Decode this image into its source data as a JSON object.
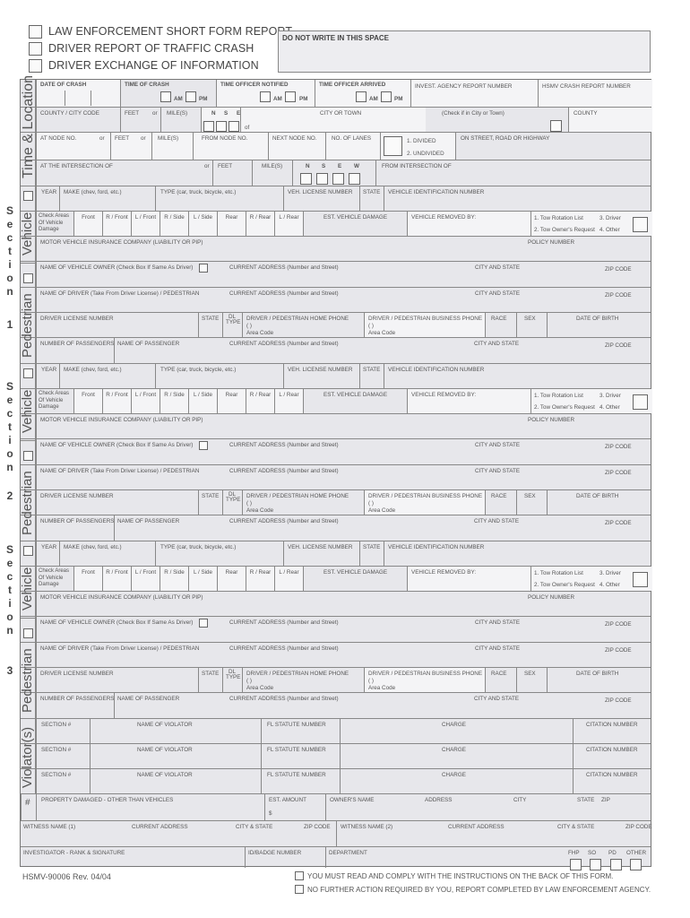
{
  "header": {
    "options": [
      {
        "label": "LAW ENFORCEMENT SHORT FORM REPORT",
        "checked": false
      },
      {
        "label": "DRIVER REPORT OF TRAFFIC CRASH",
        "checked": false
      },
      {
        "label": "DRIVER EXCHANGE OF INFORMATION",
        "checked": false
      }
    ],
    "do_not_write": "DO NOT WRITE IN THIS SPACE"
  },
  "time_location": {
    "section_label": "Time & Location",
    "date_of_crash": "DATE OF CRASH",
    "time_of_crash": "TIME OF CRASH",
    "time_officer_notified": "TIME OFFICER NOTIFIED",
    "time_officer_arrived": "TIME OFFICER ARRIVED",
    "am": "AM",
    "pm": "PM",
    "invest_agency_report_number": "INVEST. AGENCY REPORT NUMBER",
    "hsmv_crash_report_number": "HSMV CRASH REPORT NUMBER",
    "county_city_code": "COUNTY / CITY CODE",
    "feet": "FEET",
    "or": "or",
    "miles": "MILE(S)",
    "directions": [
      "N",
      "S",
      "E",
      "W"
    ],
    "of": "of",
    "city_or_town": "CITY OR TOWN",
    "check_if_in_city": "(Check if in City or Town)",
    "county": "COUNTY",
    "at_node_no": "AT NODE NO.",
    "from_node_no": "FROM NODE NO.",
    "next_node_no": "NEXT NODE NO.",
    "no_of_lanes": "NO. OF LANES",
    "divided": "1. DIVIDED",
    "undivided": "2. UNDIVIDED",
    "on_street": "ON STREET, ROAD OR HIGHWAY",
    "at_intersection_of": "AT THE INTERSECTION OF",
    "from_intersection_of": "FROM INTERSECTION OF"
  },
  "section_common": {
    "section_word": "Section",
    "vehicle_label": "Vehicle",
    "pedestrian_label": "Pedestrian",
    "year": "YEAR",
    "make": "MAKE (chev, ford, etc.)",
    "type": "TYPE (car, truck, bicycle, etc.)",
    "veh_license_number": "VEH. LICENSE NUMBER",
    "state": "STATE",
    "vin": "VEHICLE IDENTIFICATION NUMBER",
    "check_areas": "Check Areas Of Vehicle Damage",
    "damage_areas": [
      "Front",
      "R / Front",
      "L / Front",
      "R / Side",
      "L / Side",
      "Rear",
      "R / Rear",
      "L / Rear"
    ],
    "est_vehicle_damage": "EST. VEHICLE DAMAGE",
    "vehicle_removed_by": "VEHICLE REMOVED BY:",
    "tow_options": [
      "1. Tow Rotation List",
      "3. Driver",
      "2. Tow Owner's Request",
      "4. Other"
    ],
    "insurance_company": "MOTOR VEHICLE INSURANCE COMPANY (LIABILITY OR PIP)",
    "policy_number": "POLICY NUMBER",
    "name_of_owner": "NAME OF VEHICLE OWNER (Check Box If Same As Driver)",
    "current_address": "CURRENT ADDRESS (Number and Street)",
    "city_and_state": "CITY AND STATE",
    "zip_code": "ZIP CODE",
    "name_of_driver": "NAME OF DRIVER (Take From Driver License) / PEDESTRIAN",
    "driver_license_number": "DRIVER LICENSE NUMBER",
    "dl_type": "DL TYPE",
    "home_phone": "DRIVER / PEDESTRIAN HOME PHONE",
    "business_phone": "DRIVER / PEDESTRIAN BUSINESS PHONE",
    "phone_paren": "(          )",
    "area_code": "Area Code",
    "race": "RACE",
    "sex": "SEX",
    "date_of_birth": "DATE OF BIRTH",
    "number_of_passengers": "NUMBER OF PASSENGERS",
    "name_of_passenger": "NAME OF PASSENGER"
  },
  "sections": [
    {
      "number": "1"
    },
    {
      "number": "2"
    },
    {
      "number": "3"
    }
  ],
  "violators": {
    "section_label": "Violator(s)",
    "rows": [
      {
        "section": "SECTION #",
        "name": "NAME OF VIOLATOR",
        "statute": "FL STATUTE NUMBER",
        "charge": "CHARGE",
        "citation": "CITATION NUMBER"
      },
      {
        "section": "SECTION #",
        "name": "NAME OF VIOLATOR",
        "statute": "FL STATUTE NUMBER",
        "charge": "CHARGE",
        "citation": "CITATION NUMBER"
      },
      {
        "section": "SECTION #",
        "name": "NAME OF VIOLATOR",
        "statute": "FL STATUTE NUMBER",
        "charge": "CHARGE",
        "citation": "CITATION NUMBER"
      }
    ]
  },
  "property": {
    "hash": "#",
    "property_damaged": "PROPERTY DAMAGED - OTHER THAN VEHICLES",
    "est_amount": "EST. AMOUNT",
    "dollar": "$",
    "owners_name": "OWNER'S NAME",
    "address": "ADDRESS",
    "city": "CITY",
    "state": "STATE",
    "zip": "ZIP"
  },
  "witness": {
    "witness1": "WITNESS NAME  (1)",
    "witness2": "WITNESS NAME  (2)",
    "current_address": "CURRENT ADDRESS",
    "city_state": "CITY & STATE",
    "zip_code": "ZIP CODE"
  },
  "investigator": {
    "rank_signature": "INVESTIGATOR - RANK & SIGNATURE",
    "badge_number": "ID/BADGE NUMBER",
    "department": "DEPARTMENT",
    "agencies": [
      "FHP",
      "SO",
      "PD",
      "OTHER"
    ]
  },
  "footer": {
    "form_number": "HSMV-90006 Rev. 04/04",
    "notice1": "YOU MUST READ AND COMPLY WITH THE INSTRUCTIONS ON THE BACK OF THIS FORM.",
    "notice2": "NO FURTHER ACTION REQUIRED BY YOU, REPORT COMPLETED BY LAW ENFORCEMENT AGENCY."
  }
}
